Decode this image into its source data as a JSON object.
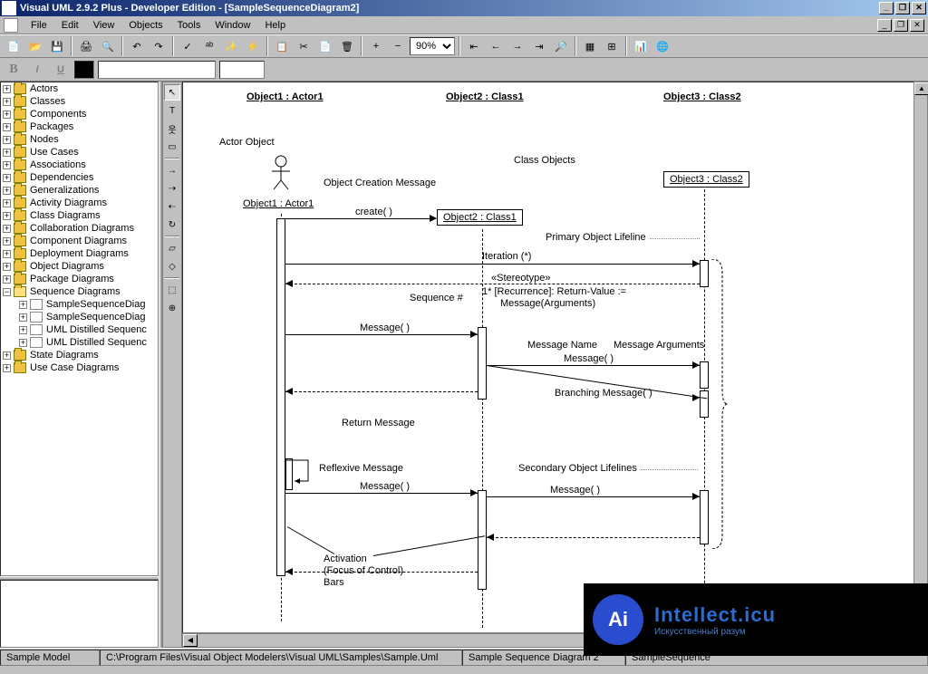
{
  "title": "Visual UML 2.9.2 Plus - Developer Edition - [SampleSequenceDiagram2]",
  "menus": [
    "File",
    "Edit",
    "View",
    "Objects",
    "Tools",
    "Window",
    "Help"
  ],
  "zoom": "90%",
  "tree": {
    "items": [
      {
        "label": "Actors"
      },
      {
        "label": "Classes"
      },
      {
        "label": "Components"
      },
      {
        "label": "Packages"
      },
      {
        "label": "Nodes"
      },
      {
        "label": "Use Cases"
      },
      {
        "label": "Associations"
      },
      {
        "label": "Dependencies"
      },
      {
        "label": "Generalizations"
      },
      {
        "label": "Activity Diagrams"
      },
      {
        "label": "Class Diagrams"
      },
      {
        "label": "Collaboration Diagrams"
      },
      {
        "label": "Component Diagrams"
      },
      {
        "label": "Deployment Diagrams"
      },
      {
        "label": "Object Diagrams"
      },
      {
        "label": "Package Diagrams"
      }
    ],
    "open_folder": "Sequence Diagrams",
    "children": [
      "SampleSequenceDiag",
      "SampleSequenceDiag",
      "UML Distilled Sequenc",
      "UML Distilled Sequenc"
    ],
    "after": [
      {
        "label": "State Diagrams"
      },
      {
        "label": "Use Case Diagrams"
      }
    ]
  },
  "diagram": {
    "headers": {
      "o1": "Object1 : Actor1",
      "o2": "Object2 : Class1",
      "o3": "Object3 : Class2"
    },
    "boxes": {
      "actor": "Object1 : Actor1",
      "obj2": "Object2 : Class1",
      "obj3": "Object3 : Class2"
    },
    "labels": {
      "actor_object": "Actor Object",
      "class_objects": "Class Objects",
      "creation": "Object Creation Message",
      "create": "create( )",
      "primary_lifeline": "Primary Object Lifeline",
      "iteration": "Iteration (*)",
      "stereotype": "«Stereotype»",
      "syntax": "1* [Recurrence]: Return-Value :=",
      "syntax2": "Message(Arguments)",
      "sequence": "Sequence #",
      "message": "Message( )",
      "msg_name": "Message Name",
      "msg_args": "Message Arguments",
      "branching": "Branching Message( )",
      "return_msg": "Return Message",
      "reflexive": "Reflexive Message",
      "secondary": "Secondary Object Lifelines",
      "activation1": "Activation",
      "activation2": "(Focus of Control)",
      "activation3": "Bars"
    }
  },
  "status": {
    "model": "Sample Model",
    "path": "C:\\Program Files\\Visual Object Modelers\\Visual UML\\Samples\\Sample.Uml",
    "diagram": "Sample Sequence Diagram 2",
    "tab": "SampleSequence"
  },
  "watermark": {
    "logo": "Ai",
    "title": "Intellect.icu",
    "sub": "Искусственный разум"
  }
}
